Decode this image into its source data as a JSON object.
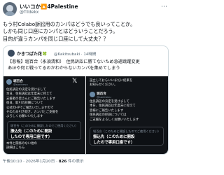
{
  "tweet": {
    "display_name": "いいコか🔼4Palestine",
    "handle": "@Tildekx",
    "text_lines": [
      "もう村Colabo訴訟用のカンパはどうでも良いってことか。",
      "しかも同じ口座にカンパとはどういうことだろう。",
      "目的が違うカンパを同じ口座にして大丈夫？？"
    ],
    "timestamp": "午後10:10 · 2026年1月20日 ·",
    "views_count": "826",
    "views_label": "件の表示"
  },
  "quote": {
    "name": "かきつばた花🍀",
    "meta": "@Kakitsubaki · 14時間",
    "text_lines": [
      "【悲報】堀百合（永須清和）　住民訴訟に勝てないため急遽跳躍変更",
      "あほや何と戦ってるのかわからないカンパを集めてしまう"
    ]
  },
  "left_image": {
    "name": "堀百合",
    "handle": "@saeinesu",
    "lines": [
      "住民訴訟の決定を受けまして",
      "本日、住民訴訟は年度末に控えて",
      "支援者の皆さんにご報告いたします",
      "後日、取引の詳細について",
      "公式のHPでご報告いたしますので",
      "そのため引き続き、カンパとご支援を",
      "よろしくお願いいたします",
      "",
      "住民訴訟の　　のため",
      "",
      "本件と関係のない他の",
      "詳細はこちら"
    ],
    "card_line1": "堀百合（このために開設したのでご使用ください）",
    "card_line2": "振込先（このために開設",
    "card_line3": "したので専用口座です）"
  },
  "right_image": {
    "name": "堀百合",
    "handle": "@saeinesu",
    "top_lines": [
      "設立しておらいいまだに結果を",
      "お知らせください。"
    ],
    "lines": [
      "堀百合",
      "@saeinesu",
      "",
      "住民訴訟の決定を受けまして",
      "本日、住民訴訟は年度末に控えて",
      "皆様にご報告いたします",
      "住民訴訟の控訴については",
      "ご支援をよろしくお願いいたします"
    ],
    "card_line1": "堀百合（このために開設したのでご使用ください）",
    "card_line2": "振込先（このために開設",
    "card_line3": "したので専用口座です）"
  }
}
